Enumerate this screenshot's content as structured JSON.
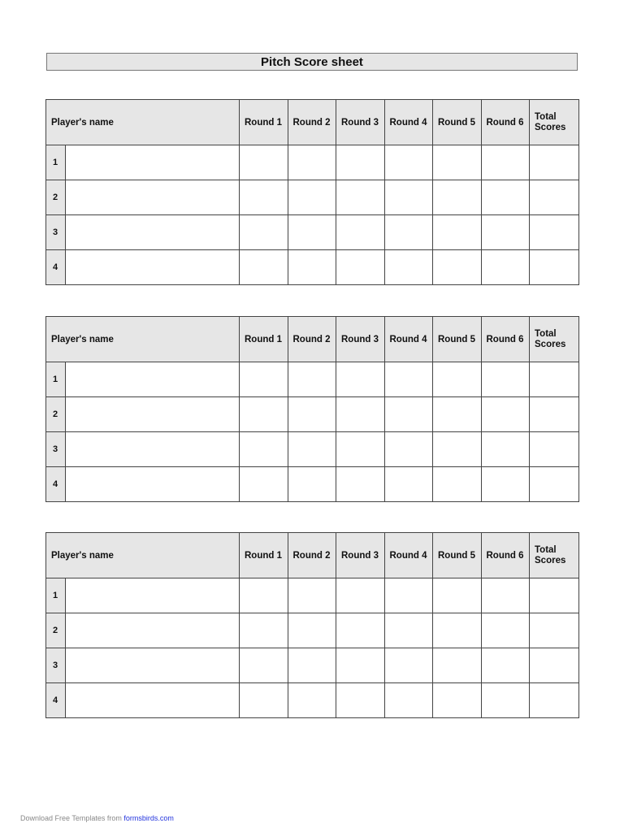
{
  "document": {
    "title": "Pitch Score sheet"
  },
  "table_headers": {
    "player_name": "Player's name",
    "rounds": [
      "Round 1",
      "Round 2",
      "Round 3",
      "Round 4",
      "Round 5",
      "Round 6"
    ],
    "total": "Total\nScores"
  },
  "tables": [
    {
      "rows": [
        {
          "num": "1"
        },
        {
          "num": "2"
        },
        {
          "num": "3"
        },
        {
          "num": "4"
        }
      ]
    },
    {
      "rows": [
        {
          "num": "1"
        },
        {
          "num": "2"
        },
        {
          "num": "3"
        },
        {
          "num": "4"
        }
      ]
    },
    {
      "rows": [
        {
          "num": "1"
        },
        {
          "num": "2"
        },
        {
          "num": "3"
        },
        {
          "num": "4"
        }
      ]
    }
  ],
  "footer": {
    "text": "Download Free Templates from ",
    "link_text": "formsbirds.com",
    "link_color": "#2233dd"
  }
}
